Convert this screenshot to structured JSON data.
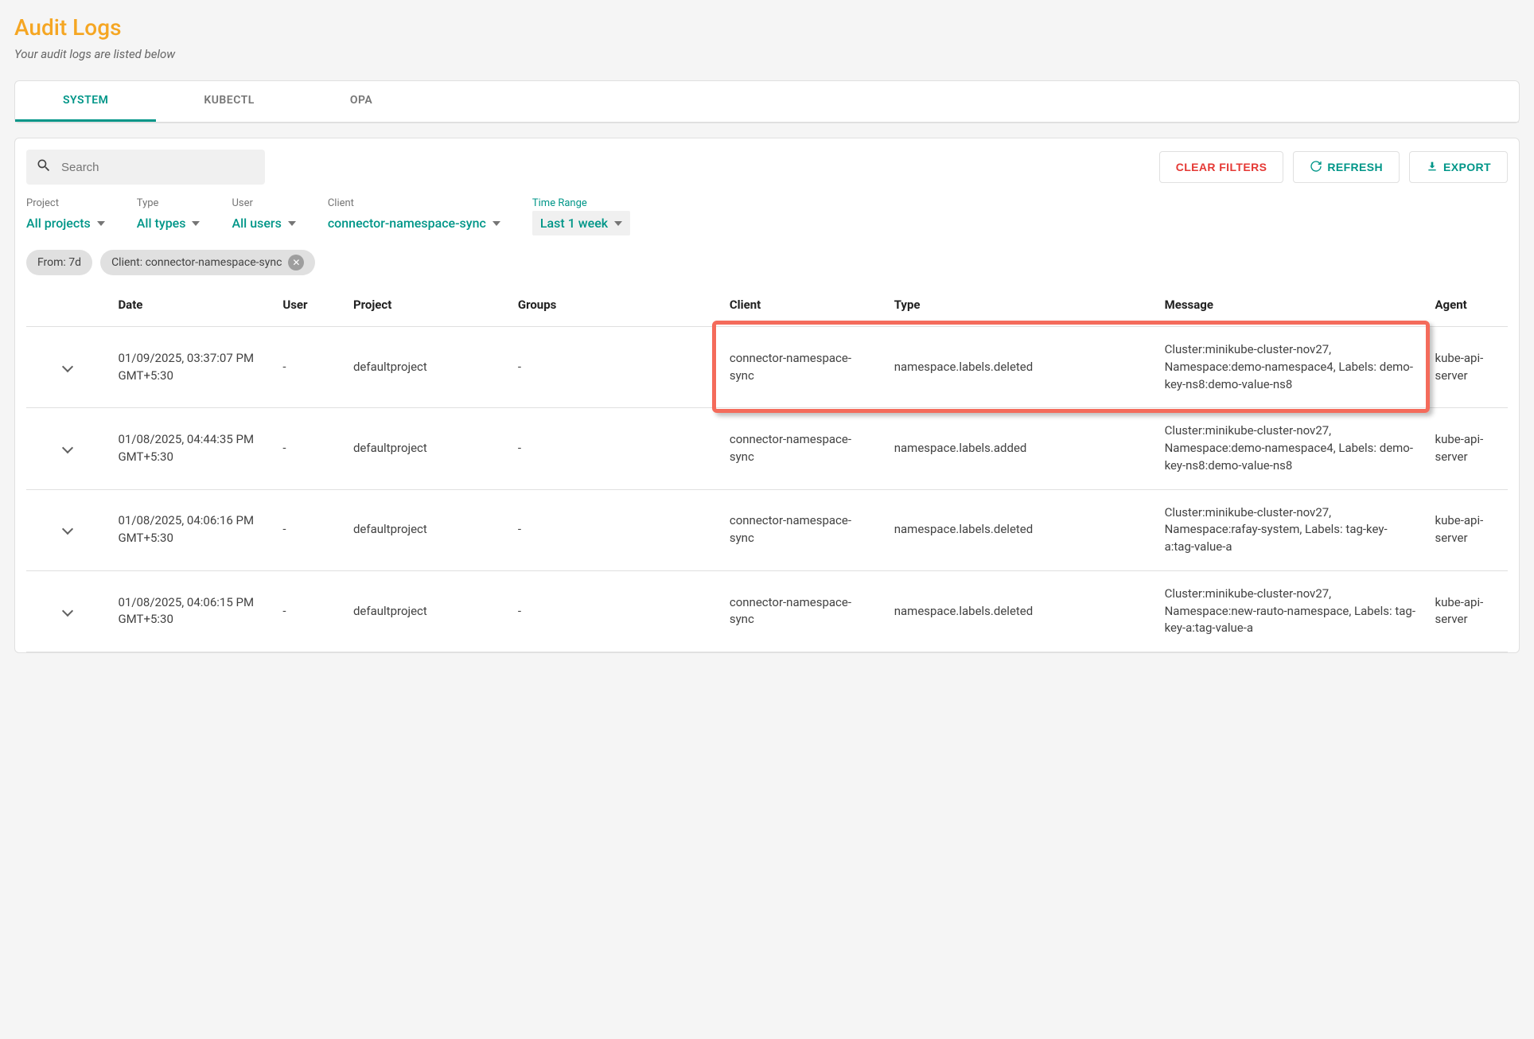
{
  "page": {
    "title": "Audit Logs",
    "subtitle": "Your audit logs are listed below"
  },
  "tabs": [
    {
      "label": "SYSTEM",
      "active": true
    },
    {
      "label": "KUBECTL",
      "active": false
    },
    {
      "label": "OPA",
      "active": false
    }
  ],
  "search": {
    "placeholder": "Search"
  },
  "buttons": {
    "clear_filters": "CLEAR FILTERS",
    "refresh": "REFRESH",
    "export": "EXPORT"
  },
  "filters": {
    "project": {
      "label": "Project",
      "value": "All projects"
    },
    "type": {
      "label": "Type",
      "value": "All types"
    },
    "user": {
      "label": "User",
      "value": "All users"
    },
    "client": {
      "label": "Client",
      "value": "connector-namespace-sync"
    },
    "time": {
      "label": "Time Range",
      "value": "Last 1 week"
    }
  },
  "chips": [
    {
      "label": "From: 7d",
      "closable": false
    },
    {
      "label": "Client: connector-namespace-sync",
      "closable": true
    }
  ],
  "columns": [
    "Date",
    "User",
    "Project",
    "Groups",
    "Client",
    "Type",
    "Message",
    "Agent"
  ],
  "rows": [
    {
      "date": "01/09/2025, 03:37:07 PM GMT+5:30",
      "user": "-",
      "project": "defaultproject",
      "groups": "-",
      "client": "connector-namespace-sync",
      "type": "namespace.labels.deleted",
      "message": "Cluster:minikube-cluster-nov27, Namespace:demo-namespace4, Labels: demo-key-ns8:demo-value-ns8",
      "agent": "kube-api-server",
      "highlighted": true
    },
    {
      "date": "01/08/2025, 04:44:35 PM GMT+5:30",
      "user": "-",
      "project": "defaultproject",
      "groups": "-",
      "client": "connector-namespace-sync",
      "type": "namespace.labels.added",
      "message": "Cluster:minikube-cluster-nov27, Namespace:demo-namespace4, Labels: demo-key-ns8:demo-value-ns8",
      "agent": "kube-api-server"
    },
    {
      "date": "01/08/2025, 04:06:16 PM GMT+5:30",
      "user": "-",
      "project": "defaultproject",
      "groups": "-",
      "client": "connector-namespace-sync",
      "type": "namespace.labels.deleted",
      "message": "Cluster:minikube-cluster-nov27, Namespace:rafay-system, Labels: tag-key-a:tag-value-a",
      "agent": "kube-api-server"
    },
    {
      "date": "01/08/2025, 04:06:15 PM GMT+5:30",
      "user": "-",
      "project": "defaultproject",
      "groups": "-",
      "client": "connector-namespace-sync",
      "type": "namespace.labels.deleted",
      "message": "Cluster:minikube-cluster-nov27, Namespace:new-rauto-namespace, Labels: tag-key-a:tag-value-a",
      "agent": "kube-api-server"
    }
  ]
}
